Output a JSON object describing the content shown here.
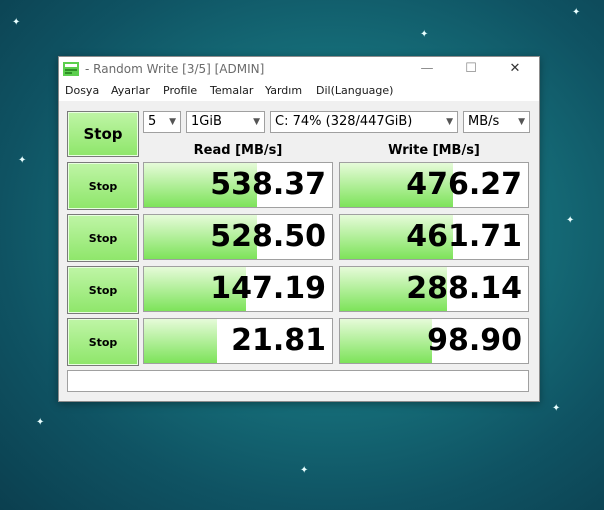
{
  "window": {
    "title": "- Random Write [3/5] [ADMIN]",
    "controls": {
      "minimize": "—",
      "maximize": "☐",
      "close": "✕"
    }
  },
  "menu": [
    "Dosya",
    "Ayarlar",
    "Profile",
    "Temalar",
    "Yardım",
    "Dil(Language)"
  ],
  "controls": {
    "main_button": "Stop",
    "count": "5",
    "size": "1GiB",
    "drive": "C: 74% (328/447GiB)",
    "unit": "MB/s"
  },
  "headers": {
    "read": "Read [MB/s]",
    "write": "Write [MB/s]"
  },
  "rows": [
    {
      "button": "Stop",
      "read": "538.37",
      "write": "476.27",
      "read_level": 0.6,
      "write_level": 0.6
    },
    {
      "button": "Stop",
      "read": "528.50",
      "write": "461.71",
      "read_level": 0.6,
      "write_level": 0.6
    },
    {
      "button": "Stop",
      "read": "147.19",
      "write": "288.14",
      "read_level": 0.54,
      "write_level": 0.57
    },
    {
      "button": "Stop",
      "read": "21.81",
      "write": "98.90",
      "read_level": 0.39,
      "write_level": 0.49
    }
  ],
  "status_text": "",
  "colors": {
    "accent_green": "#7de35a",
    "button_green": "#8ee66a"
  }
}
